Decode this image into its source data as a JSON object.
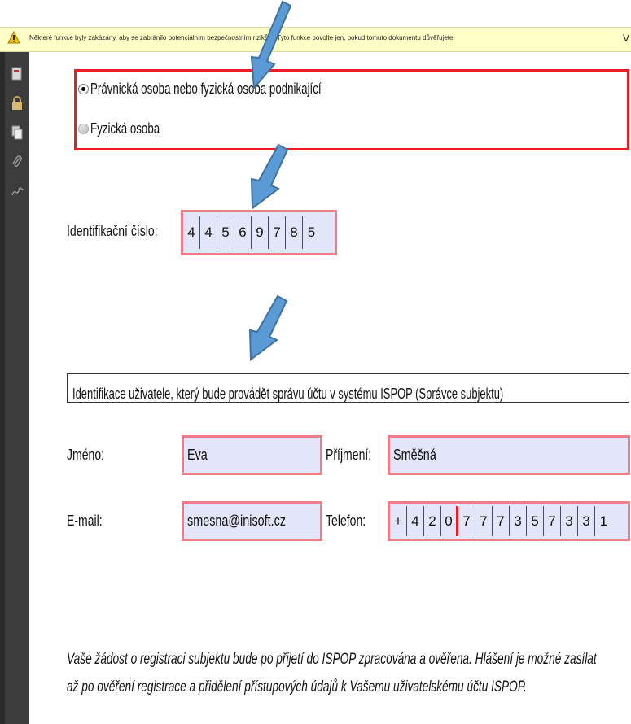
{
  "warning_bar": {
    "text": "Některé funkce byly zakázány, aby se zabránilo potenciálním bezpečnostním rizikům. Tyto funkce povolte jen, pokud tomuto dokumentu důvěřujete.",
    "right_char": "V"
  },
  "subject_type": {
    "options": [
      {
        "label": "Právnická osoba nebo fyzická osoba podnikající",
        "checked": true
      },
      {
        "label": "Fyzická osoba",
        "checked": false
      }
    ]
  },
  "ico": {
    "label": "Identifikační číslo:",
    "digits": [
      "4",
      "4",
      "5",
      "6",
      "9",
      "7",
      "8",
      "5"
    ]
  },
  "admin_section": {
    "title": "Identifikace uživatele, který bude provádět správu účtu v systému ISPOP (Správce subjektu)"
  },
  "form": {
    "first_name_label": "Jméno:",
    "first_name_value": "Eva",
    "last_name_label": "Příjmení:",
    "last_name_value": "Směšná",
    "email_label": "E-mail:",
    "email_value": "smesna@inisoft.cz",
    "phone_label": "Telefon:",
    "phone_prefix": [
      "+",
      "4",
      "2",
      "0"
    ],
    "phone_number": [
      "7",
      "7",
      "7",
      "3",
      "5",
      "7",
      "3",
      "3",
      "1"
    ]
  },
  "note": {
    "line1": "Vaše žádost o registraci subjektu bude po přijetí do ISPOP zpracována a ověřena. Hlášení je možné zasílat",
    "line2": "až po ověření registrace a přidělení přístupových údajů k Vašemu uživatelskému účtu ISPOP."
  },
  "colors": {
    "highlight_red": "#ee1c25",
    "field_border": "#f07c8a",
    "field_fill": "#e3e5f8",
    "arrow_blue": "#5b9bd5"
  }
}
